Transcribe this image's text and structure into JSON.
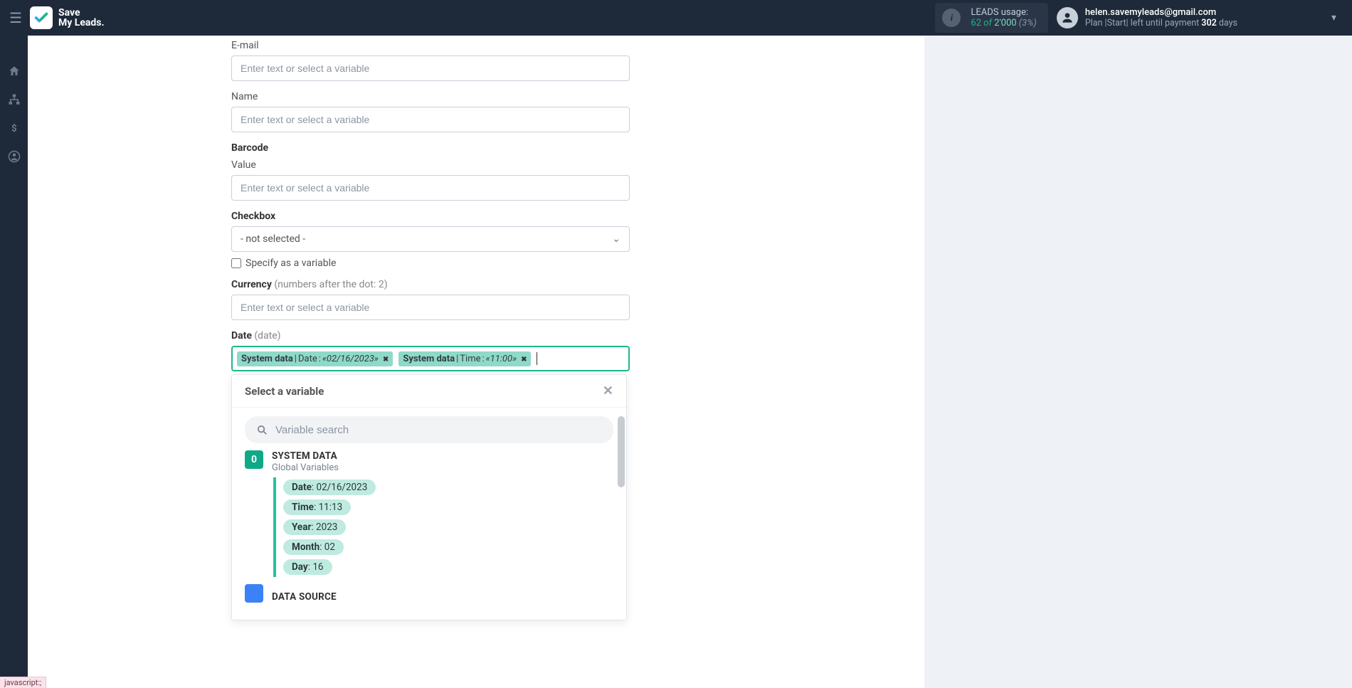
{
  "header": {
    "logo_line1": "Save",
    "logo_line2": "My Leads.",
    "usage_label": "LEADS usage:",
    "usage_used": "62",
    "usage_of": "of",
    "usage_total": "2'000",
    "usage_pct": "(3%)",
    "account_email": "helen.savemyleads@gmail.com",
    "plan_prefix": "Plan |Start| left until payment ",
    "plan_days": "302",
    "plan_suffix": " days"
  },
  "form": {
    "email_label": "E-mail",
    "email_placeholder": "Enter text or select a variable",
    "name_label": "Name",
    "name_placeholder": "Enter text or select a variable",
    "barcode_heading": "Barcode",
    "value_label": "Value",
    "value_placeholder": "Enter text or select a variable",
    "checkbox_heading": "Checkbox",
    "checkbox_select": "- not selected -",
    "specify_label": "Specify as a variable",
    "currency_label": "Currency",
    "currency_hint": "(numbers after the dot: 2)",
    "currency_placeholder": "Enter text or select a variable",
    "date_label": "Date",
    "date_hint": "(date)",
    "tags": [
      {
        "source": "System data",
        "field": "Date",
        "value": "«02/16/2023»"
      },
      {
        "source": "System data",
        "field": "Time",
        "value": "«11:00»"
      }
    ]
  },
  "dropdown": {
    "title": "Select a variable",
    "search_placeholder": "Variable search",
    "group0_title": "SYSTEM DATA",
    "group0_sub": "Global Variables",
    "items": [
      {
        "k": "Date",
        "v": "02/16/2023"
      },
      {
        "k": "Time",
        "v": "11:13"
      },
      {
        "k": "Year",
        "v": "2023"
      },
      {
        "k": "Month",
        "v": "02"
      },
      {
        "k": "Day",
        "v": "16"
      }
    ],
    "group1_title": "DATA SOURCE"
  },
  "status": "javascript:;"
}
